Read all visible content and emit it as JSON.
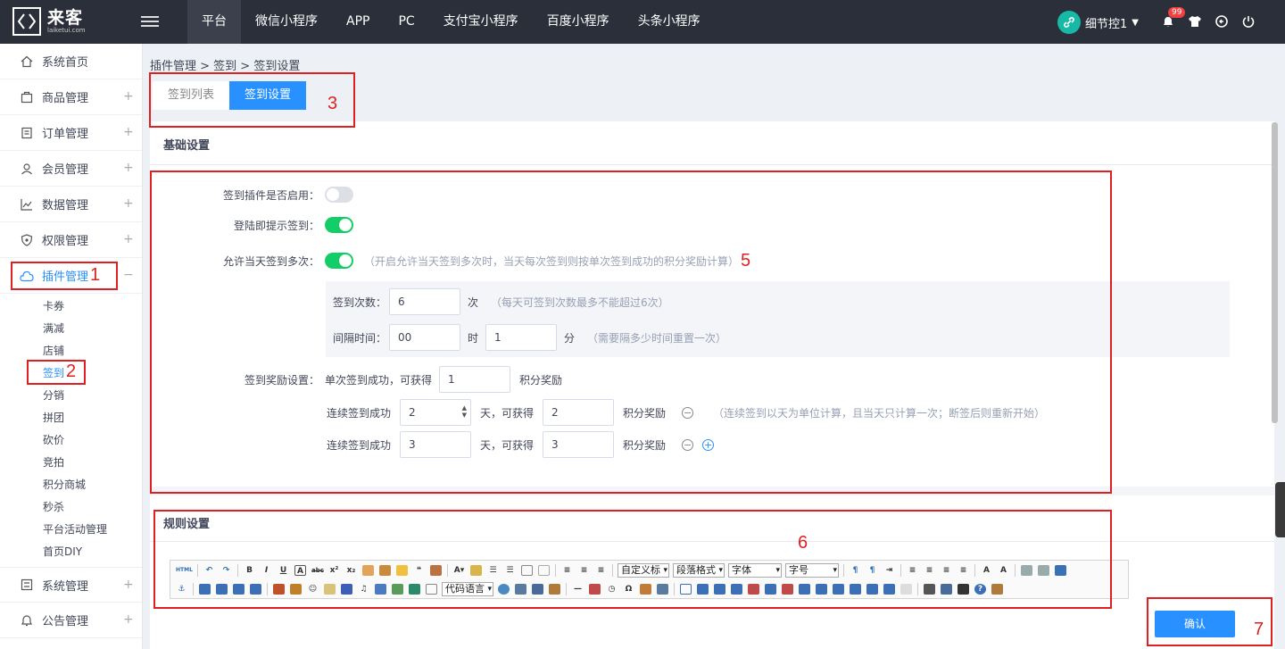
{
  "brand": {
    "name": "来客",
    "url": "laiketui.com"
  },
  "topnav": [
    "平台",
    "微信小程序",
    "APP",
    "PC",
    "支付宝小程序",
    "百度小程序",
    "头条小程序"
  ],
  "user": {
    "name": "细节控1",
    "notifications": "99"
  },
  "sidebar": {
    "items": [
      {
        "label": "系统首页",
        "icon": "home-icon"
      },
      {
        "label": "商品管理",
        "icon": "goods-icon"
      },
      {
        "label": "订单管理",
        "icon": "order-icon"
      },
      {
        "label": "会员管理",
        "icon": "member-icon"
      },
      {
        "label": "数据管理",
        "icon": "chart-icon"
      },
      {
        "label": "权限管理",
        "icon": "shield-icon"
      },
      {
        "label": "插件管理",
        "icon": "plugin-icon"
      }
    ],
    "subitems": [
      "卡券",
      "满减",
      "店铺",
      "签到",
      "分销",
      "拼团",
      "砍价",
      "竞拍",
      "积分商城",
      "秒杀",
      "平台活动管理",
      "首页DIY"
    ],
    "bottom_items": [
      {
        "label": "系统管理",
        "icon": "settings-icon"
      },
      {
        "label": "公告管理",
        "icon": "bell-icon"
      }
    ]
  },
  "breadcrumb": "插件管理 > 签到 > 签到设置",
  "tabs": [
    "签到列表",
    "签到设置"
  ],
  "basic": {
    "title": "基础设置",
    "enable_label": "签到插件是否启用：",
    "login_prompt_label": "登陆即提示签到：",
    "multi_label": "允许当天签到多次：",
    "multi_hint": "（开启允许当天签到多次时，当天每次签到则按单次签到成功的积分奖励计算）",
    "times_label": "签到次数：",
    "times_value": "6",
    "times_unit": "次",
    "times_hint": "（每天可签到次数最多不能超过6次）",
    "interval_label": "间隔时间：",
    "interval_hour": "00",
    "hour_unit": "时",
    "interval_minute": "1",
    "minute_unit": "分",
    "interval_hint": "（需要隔多少时间重置一次）",
    "reward_label": "签到奖励设置：",
    "single_text": "单次签到成功，可获得",
    "single_value": "1",
    "points_text": "积分奖励",
    "consec_text": "连续签到成功",
    "get_text": "天，可获得",
    "consec_rows": [
      {
        "days": "2",
        "points": "2"
      },
      {
        "days": "3",
        "points": "3"
      }
    ],
    "consec_hint": "（连续签到以天为单位计算，且当天只计算一次；断签后则重新开始）"
  },
  "toggles": {
    "enable": false,
    "login_prompt": true,
    "multi": true
  },
  "rules": {
    "title": "规则设置"
  },
  "editor": {
    "html_label": "HTML",
    "selects": [
      "自定义标",
      "段落格式",
      "字体",
      "字号"
    ],
    "code_select": "代码语言"
  },
  "confirm_label": "确认",
  "annotations": [
    "1",
    "2",
    "3",
    "5",
    "6",
    "7"
  ]
}
